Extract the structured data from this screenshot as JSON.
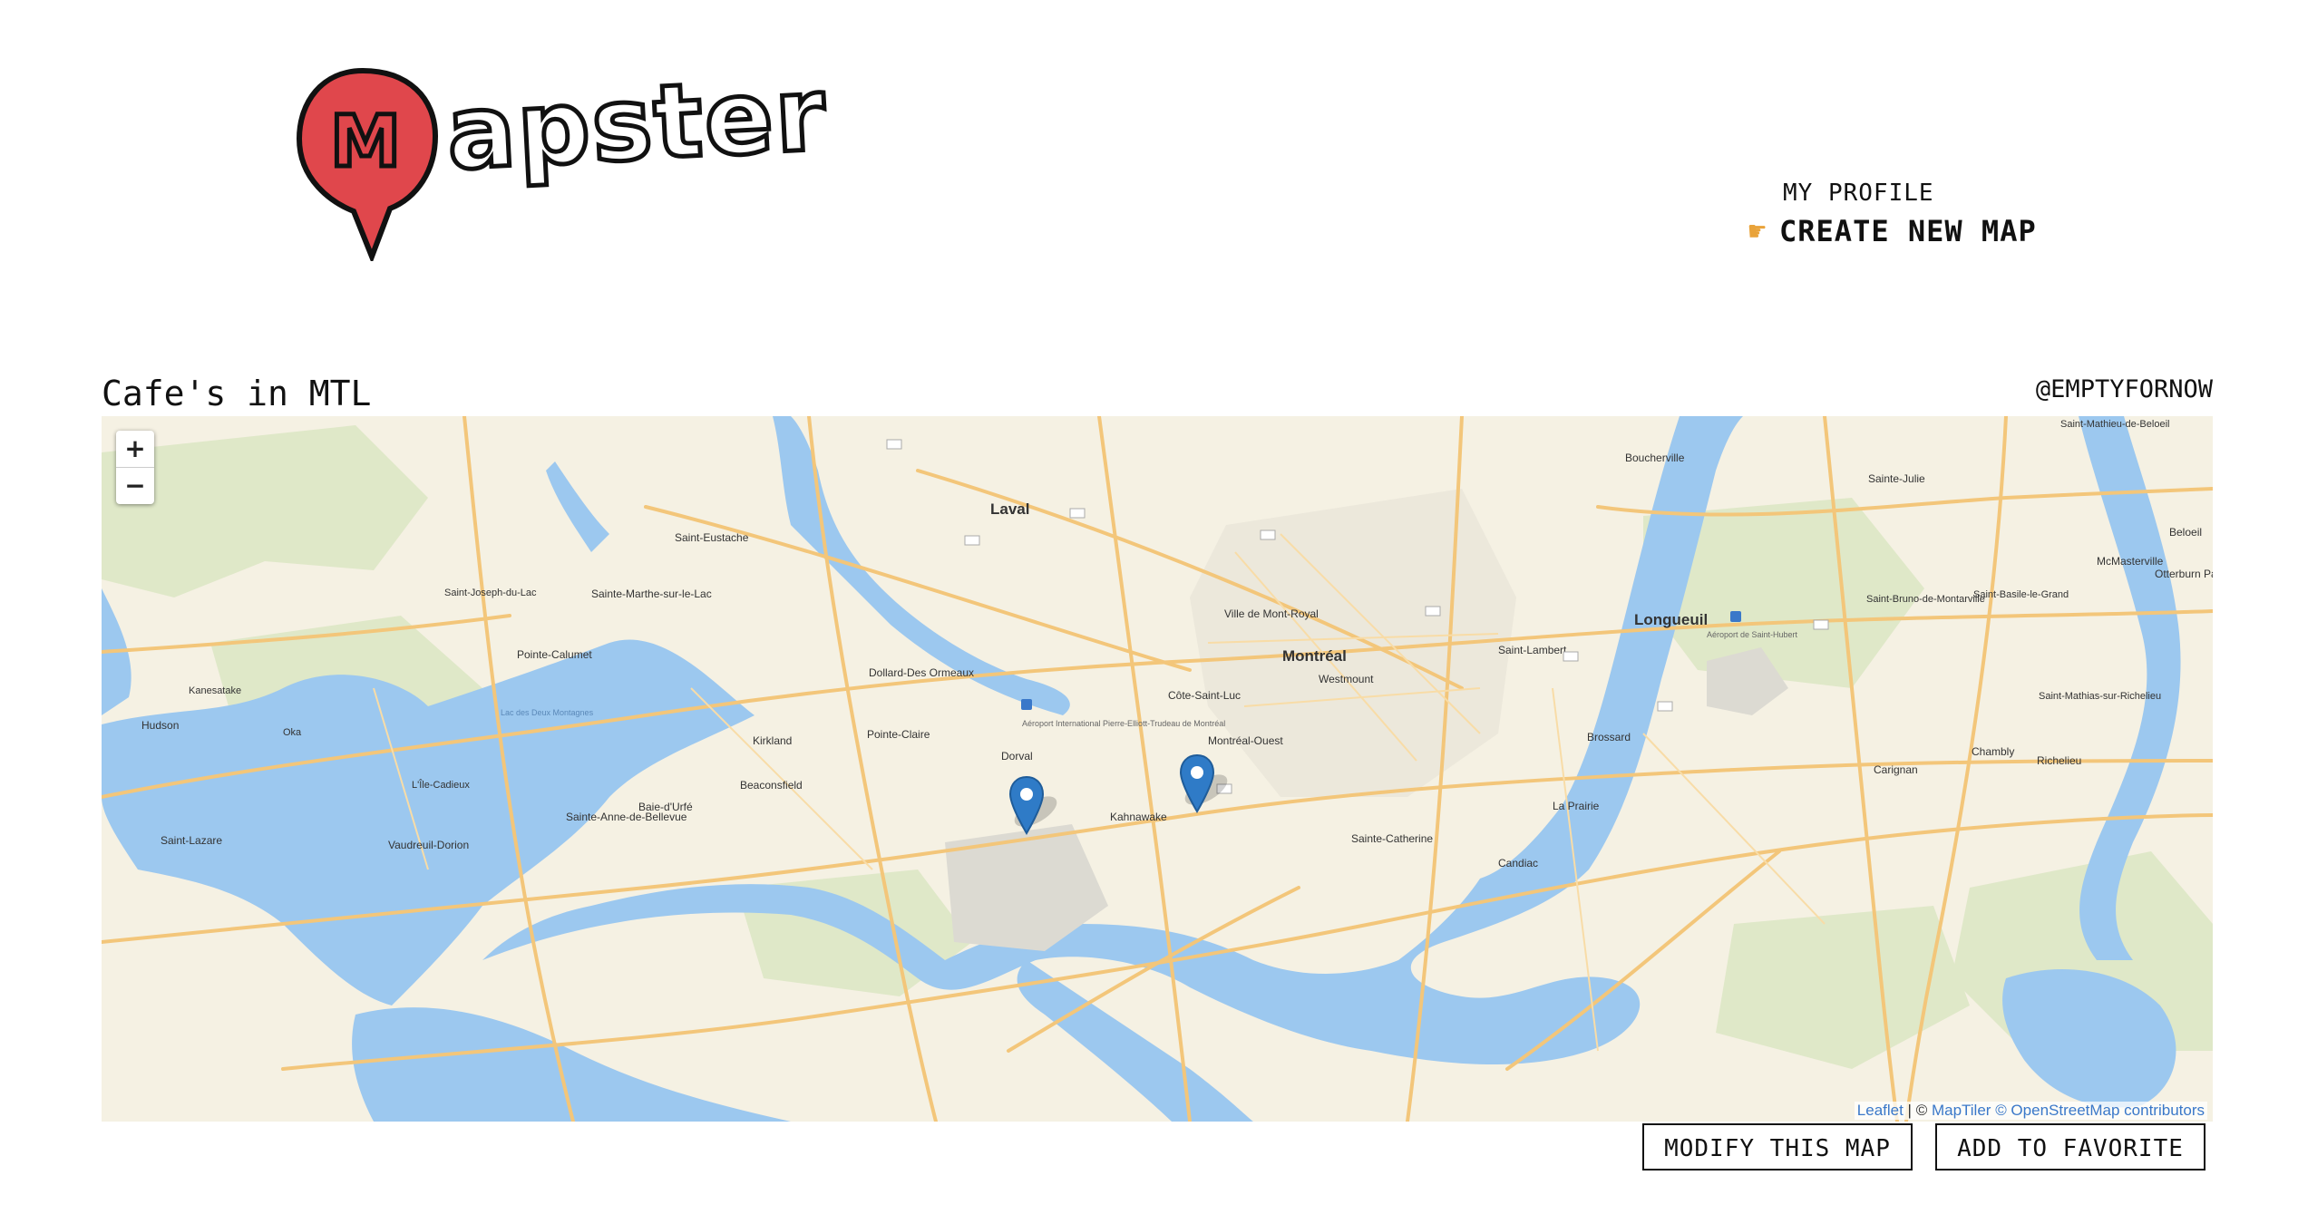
{
  "header": {
    "logo_text": "Mapster",
    "logo_initial": "M",
    "nav": {
      "profile_label": "MY PROFILE",
      "create_label": "CREATE NEW MAP",
      "create_pointer_icon": "pointing-hand-icon"
    }
  },
  "map_view": {
    "title": "Cafe's in MTL",
    "author": "@EMPTYFORNOW",
    "zoom_in_label": "+",
    "zoom_out_label": "−",
    "attribution": {
      "leaflet": "Leaflet",
      "separator": " | © ",
      "maptiler": "MapTiler",
      "osm": "© OpenStreetMap contributors"
    },
    "markers": [
      {
        "name": "marker near Dorval airport",
        "color": "#2f7bc7"
      },
      {
        "name": "marker Côte-Saint-Luc",
        "color": "#2f7bc7"
      }
    ],
    "place_labels": {
      "laval": "Laval",
      "montreal": "Montréal",
      "longueuil": "Longueuil",
      "saint_eustache": "Saint-Eustache",
      "sainte_marthe": "Sainte-Marthe-sur-le-Lac",
      "saint_joseph": "Saint-Joseph-du-Lac",
      "pointe_calumet": "Pointe-Calumet",
      "kanesatake": "Kanesatake",
      "hudson": "Hudson",
      "oka": "Oka",
      "dollard": "Dollard-Des Ormeaux",
      "pointe_claire": "Pointe-Claire",
      "kirkland": "Kirkland",
      "dorval": "Dorval",
      "beaconsfield": "Beaconsfield",
      "baie_durfe": "Baie-d'Urfé",
      "sainte_anne": "Sainte-Anne-de-Bellevue",
      "vaudreuil": "Vaudreuil-Dorion",
      "saint_lazare": "Saint-Lazare",
      "ile_cadieux": "L'Île-Cadieux",
      "westmount": "Westmount",
      "cote_saint_luc": "Côte-Saint-Luc",
      "montreal_ouest": "Montréal-Ouest",
      "ville_mont_royal": "Ville de Mont-Royal",
      "kahnawake": "Kahnawake",
      "sainte_catherine": "Sainte-Catherine",
      "candiac": "Candiac",
      "la_prairie": "La Prairie",
      "brossard": "Brossard",
      "saint_lambert": "Saint-Lambert",
      "boucherville": "Boucherville",
      "sainte_julie": "Sainte-Julie",
      "saint_bruno": "Saint-Bruno-de-Montarville",
      "saint_basile": "Saint-Basile-le-Grand",
      "mcmasterville": "McMasterville",
      "beloeil": "Beloeil",
      "otterburn": "Otterburn Pa",
      "saint_mathieu": "Saint-Mathieu-de-Beloeil",
      "saint_mathias": "Saint-Mathias-sur-Richelieu",
      "chambly": "Chambly",
      "carignan": "Carignan",
      "richelieu": "Richelieu",
      "airport": "Aéroport International Pierre-Elliott-Trudeau de Montréal",
      "airport_sh": "Aéroport de Saint-Hubert",
      "lac_deux_montagnes": "Lac des Deux Montagnes"
    }
  },
  "actions": {
    "modify_label": "MODIFY THIS MAP",
    "favorite_label": "ADD TO FAVORITE"
  },
  "colors": {
    "logo_red": "#e0474c",
    "water": "#9cc8ef",
    "land": "#f5f1e3",
    "park": "#dfe8c8",
    "road": "#f3c67a",
    "marker": "#2f7bc7"
  }
}
